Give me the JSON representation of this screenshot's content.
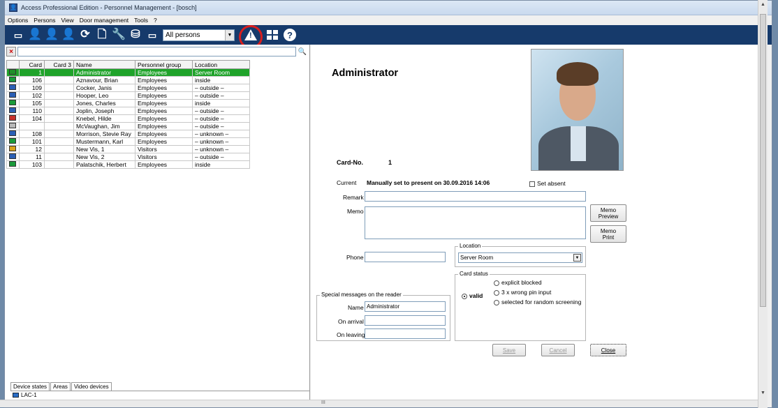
{
  "window": {
    "title": "Access Professional Edition - Personnel Management - [bosch]"
  },
  "menu": [
    "Options",
    "Persons",
    "View",
    "Door management",
    "Tools",
    "?"
  ],
  "toolbar": {
    "filter_value": "All persons"
  },
  "search": {
    "placeholder": ""
  },
  "table": {
    "columns": [
      "Card",
      "Card 3",
      "Name",
      "Personnel group",
      "Location"
    ],
    "rows": [
      {
        "card": "1",
        "card3": "",
        "name": "Administrator",
        "group": "Employees",
        "location": "Server Room",
        "icon_color": "#1f8f2a"
      },
      {
        "card": "106",
        "card3": "",
        "name": "Aznavour, Brian",
        "group": "Employees",
        "location": "inside",
        "icon_color": "#1a9a3a"
      },
      {
        "card": "109",
        "card3": "",
        "name": "Cocker, Janis",
        "group": "Employees",
        "location": "– outside –",
        "icon_color": "#2b5fb5"
      },
      {
        "card": "102",
        "card3": "",
        "name": "Hooper, Leo",
        "group": "Employees",
        "location": "– outside –",
        "icon_color": "#2b5fb5"
      },
      {
        "card": "105",
        "card3": "",
        "name": "Jones, Charles",
        "group": "Employees",
        "location": "inside",
        "icon_color": "#1a9a3a"
      },
      {
        "card": "110",
        "card3": "",
        "name": "Joplin, Joseph",
        "group": "Employees",
        "location": "– outside –",
        "icon_color": "#2b5fb5"
      },
      {
        "card": "104",
        "card3": "",
        "name": "Knebel, Hilde",
        "group": "Employees",
        "location": "– outside –",
        "icon_color": "#c8302a"
      },
      {
        "card": "",
        "card3": "",
        "name": "McVaughan, Jim",
        "group": "Employees",
        "location": "– outside –",
        "icon_color": "#b8b8b8"
      },
      {
        "card": "108",
        "card3": "",
        "name": "Morrison, Stevie Ray",
        "group": "Employees",
        "location": "– unknown –",
        "icon_color": "#2b5fb5"
      },
      {
        "card": "101",
        "card3": "",
        "name": "Mustermann, Karl",
        "group": "Employees",
        "location": "– unknown –",
        "icon_color": "#1a9a3a"
      },
      {
        "card": "12",
        "card3": "",
        "name": "New Vis, 1",
        "group": "Visitors",
        "location": "– unknown –",
        "icon_color": "#d9a21a"
      },
      {
        "card": "11",
        "card3": "",
        "name": "New Vis, 2",
        "group": "Visitors",
        "location": "– outside –",
        "icon_color": "#2b5fb5"
      },
      {
        "card": "103",
        "card3": "",
        "name": "Palatschik, Herbert",
        "group": "Employees",
        "location": "inside",
        "icon_color": "#1a9a3a"
      }
    ]
  },
  "bottom_tabs": [
    "Device states",
    "Areas",
    "Video devices"
  ],
  "device": {
    "label": "LAC-1"
  },
  "detail": {
    "name": "Administrator",
    "card_no_label": "Card-No.",
    "card_no": "1",
    "current_label": "Current",
    "current_value": "Manually set to present on 30.09.2016 14:06",
    "set_absent": "Set absent",
    "remark_label": "Remark",
    "memo_label": "Memo",
    "memo_preview": "Memo Preview",
    "memo_print": "Memo Print",
    "phone_label": "Phone",
    "location_group": "Location",
    "location_value": "Server Room",
    "card_status_group": "Card status",
    "status_valid": "valid",
    "status_explicit": "explicit blocked",
    "status_pin": "3 x wrong pin input",
    "status_random": "selected for random screening",
    "special_group": "Special messages on the reader",
    "sm_name_label": "Name",
    "sm_name_value": "Administrator",
    "sm_arrival_label": "On arrival",
    "sm_leaving_label": "On leaving",
    "save": "Save",
    "cancel": "Cancel",
    "close": "Close"
  }
}
